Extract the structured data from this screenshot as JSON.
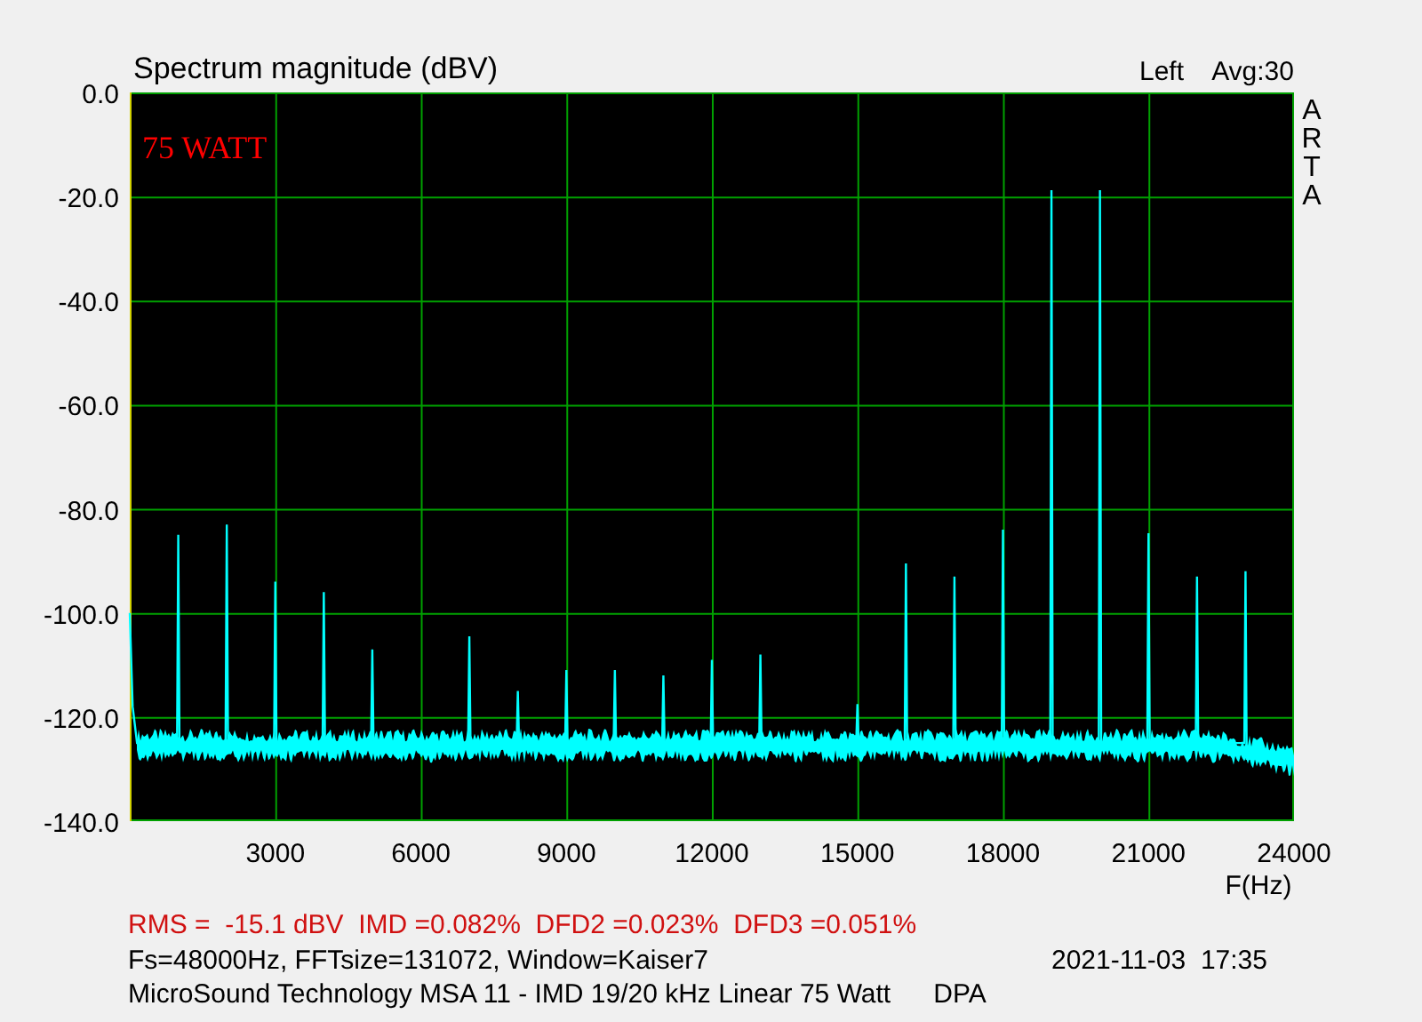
{
  "plot": {
    "average": "Avg:30",
    "brand": "ARTA",
    "annotation": "75 WATT",
    "chart_data": {
      "type": "line",
      "title": "Spectrum magnitude (dBV)",
      "xlabel": "F(Hz)",
      "x": [
        0,
        60,
        150,
        975,
        1000,
        1025,
        1975,
        2000,
        2025,
        2975,
        3000,
        3025,
        3975,
        4000,
        4025,
        4975,
        5000,
        5025,
        6975,
        7000,
        7025,
        7975,
        8000,
        8025,
        8975,
        9000,
        9025,
        9975,
        10000,
        10025,
        10975,
        11000,
        11025,
        11975,
        12000,
        12025,
        12975,
        13000,
        13025,
        14975,
        15000,
        15025,
        15975,
        16000,
        16025,
        16975,
        17000,
        17025,
        17975,
        18000,
        18025,
        18975,
        19000,
        19025,
        19975,
        20000,
        20025,
        20975,
        21000,
        21025,
        21975,
        22000,
        22025,
        22975,
        23000,
        23025,
        24000
      ],
      "series": [
        {
          "name": "Left",
          "color": "#00ffff",
          "values": [
            -100,
            -118,
            -125,
            -125,
            -85,
            -125,
            -125,
            -83,
            -125,
            -125,
            -94,
            -125,
            -125,
            -96,
            -125,
            -125,
            -107,
            -125,
            -125,
            -104.5,
            -125,
            -125,
            -115,
            -125,
            -125,
            -111,
            -125,
            -125,
            -111,
            -125,
            -125,
            -112,
            -125,
            -125,
            -109,
            -125,
            -125,
            -108,
            -125,
            -125,
            -117.5,
            -125,
            -125,
            -90.5,
            -125,
            -125,
            -93,
            -125,
            -125,
            -84,
            -125,
            -125,
            -18.8,
            -125,
            -125,
            -18.8,
            -125,
            -125,
            -84.7,
            -125,
            -125,
            -93,
            -125,
            -125,
            -92,
            -128,
            -128
          ]
        }
      ],
      "grid": true,
      "xlim": [
        0,
        24000
      ],
      "ylim": [
        -140,
        0
      ],
      "xticks": [
        3000,
        6000,
        9000,
        12000,
        15000,
        18000,
        21000,
        24000
      ],
      "yticks": [
        {
          "value": 0,
          "label": "0.0"
        },
        {
          "value": -20,
          "label": "-20.0"
        },
        {
          "value": -40,
          "label": "-40.0"
        },
        {
          "value": -60,
          "label": "-60.0"
        },
        {
          "value": -80,
          "label": "-80.0"
        },
        {
          "value": -100,
          "label": "-100.0"
        },
        {
          "value": -120,
          "label": "-120.0"
        },
        {
          "value": -140,
          "label": "-140.0"
        }
      ]
    }
  },
  "footer": {
    "measurements": "RMS =  -15.1 dBV  IMD =0.082%  DFD2 =0.023%  DFD3 =0.051%",
    "settings": "Fs=48000Hz, FFTsize=131072, Window=Kaiser7",
    "timestamp": "2021-11-03  17:35",
    "description": "MicroSound Technology MSA 11 - IMD 19/20 kHz Linear 75 Watt",
    "tag": "DPA"
  }
}
